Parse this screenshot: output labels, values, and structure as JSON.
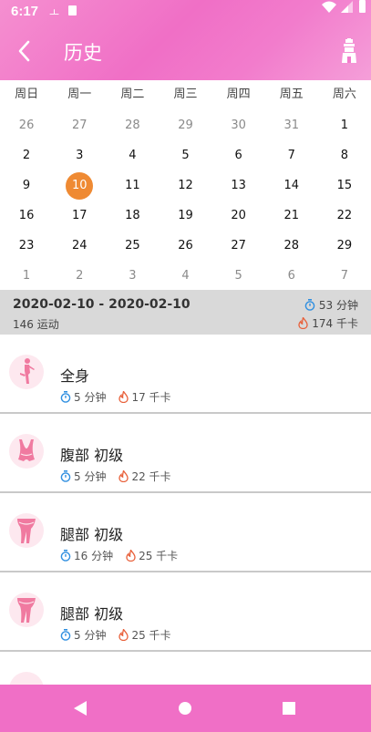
{
  "status_bar": {
    "time": "6:17",
    "notif_glyph": "ㅗ"
  },
  "header": {
    "title": "历史",
    "back_icon": "chevron-left-icon",
    "right_icon": "tower-icon"
  },
  "calendar": {
    "weekdays": [
      "周日",
      "周一",
      "周二",
      "周三",
      "周四",
      "周五",
      "周六"
    ],
    "weeks": [
      [
        "26",
        "27",
        "28",
        "29",
        "30",
        "31",
        "1"
      ],
      [
        "2",
        "3",
        "4",
        "5",
        "6",
        "7",
        "8"
      ],
      [
        "9",
        "10",
        "11",
        "12",
        "13",
        "14",
        "15"
      ],
      [
        "16",
        "17",
        "18",
        "19",
        "20",
        "21",
        "22"
      ],
      [
        "23",
        "24",
        "25",
        "26",
        "27",
        "28",
        "29"
      ],
      [
        "1",
        "2",
        "3",
        "4",
        "5",
        "6",
        "7"
      ]
    ],
    "selected": "10",
    "selected_color": "#ef8a33"
  },
  "summary": {
    "range": "2020-02-10 - 2020-02-10",
    "count": "146 运动",
    "minutes": "53 分钟",
    "kcal": "174 千卡"
  },
  "workouts": [
    {
      "name": "全身",
      "minutes": "5 分钟",
      "kcal": "17 千卡",
      "icon": "full-body-icon"
    },
    {
      "name": "腹部 初级",
      "minutes": "5 分钟",
      "kcal": "22 千卡",
      "icon": "abs-icon"
    },
    {
      "name": "腿部 初级",
      "minutes": "16 分钟",
      "kcal": "25 千卡",
      "icon": "legs-icon"
    },
    {
      "name": "腿部 初级",
      "minutes": "5 分钟",
      "kcal": "25 千卡",
      "icon": "legs-icon"
    }
  ],
  "colors": {
    "accent_pink": "#f06fc6",
    "timer_blue": "#2f8fe0",
    "flame_orange": "#e8603a"
  }
}
